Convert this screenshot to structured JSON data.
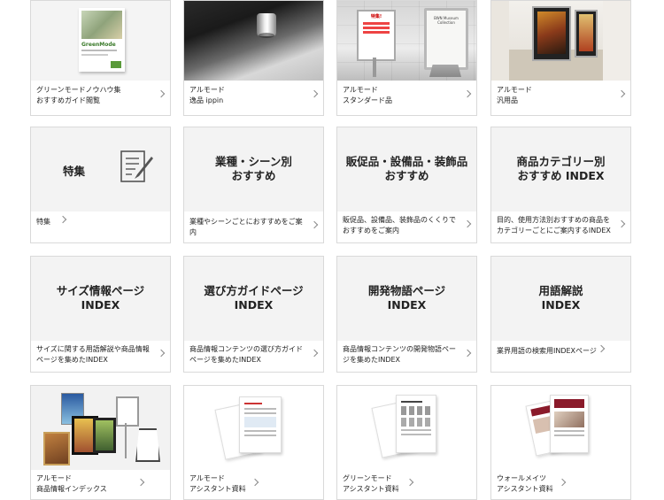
{
  "row1": [
    {
      "line1": "グリーンモードノウハウ集",
      "line2": "おすすめガイド閲覧",
      "image": "brochure-photo",
      "brochure_brand": "GreenMode"
    },
    {
      "line1": "アルモード",
      "line2": "逸品 ippin",
      "image": "metal-fixture-photo"
    },
    {
      "line1": "アルモード",
      "line2": "スタンダード品",
      "image": "sign-stands-photo",
      "sign_text_a": "特集!",
      "sign_text_b": "BWN Museum Collection"
    },
    {
      "line1": "アルモード",
      "line2": "汎用品",
      "image": "wall-posters-photo"
    }
  ],
  "row2": [
    {
      "title1": "特集",
      "title2": "",
      "caption": "特集",
      "icon": "document-pen-icon"
    },
    {
      "title1": "業種・シーン別",
      "title2": "おすすめ",
      "caption": "業種やシーンごとにおすすめをご案内"
    },
    {
      "title1": "販促品・設備品・装飾品",
      "title2": "おすすめ",
      "caption": "販促品、設備品、装飾品のくくりでおすすめをご案内"
    },
    {
      "title1": "商品カテゴリー別",
      "title2": "おすすめ INDEX",
      "caption": "目的、使用方法別おすすめの商品をカテゴリーごとにご案内するINDEX"
    }
  ],
  "row3": [
    {
      "title1": "サイズ情報ページ",
      "title2": "INDEX",
      "caption": "サイズに関する用語解説や商品情報ページを集めたINDEX"
    },
    {
      "title1": "選び方ガイドページ",
      "title2": "INDEX",
      "caption": "商品情報コンテンツの選び方ガイドページを集めたINDEX"
    },
    {
      "title1": "開発物語ページ",
      "title2": "INDEX",
      "caption": "商品情報コンテンツの開発物語ページを集めたINDEX"
    },
    {
      "title1": "用語解説",
      "title2": "INDEX",
      "caption": "業界用語の検索用INDEXページ"
    }
  ],
  "row4": [
    {
      "line1": "アルモード",
      "line2": "商品情報インデックス",
      "image": "product-lineup-photo"
    },
    {
      "line1": "アルモード",
      "line2": "アシスタント資料",
      "image": "documents-photo"
    },
    {
      "line1": "グリーンモード",
      "line2": "アシスタント資料",
      "image": "documents-photo"
    },
    {
      "line1": "ウォールメイツ",
      "line2": "アシスタント資料",
      "image": "catalog-photo"
    }
  ],
  "colors": {
    "card_border": "#d9d9d9",
    "card_top_bg": "#f3f3f3",
    "text": "#222222",
    "chevron": "#888888"
  }
}
